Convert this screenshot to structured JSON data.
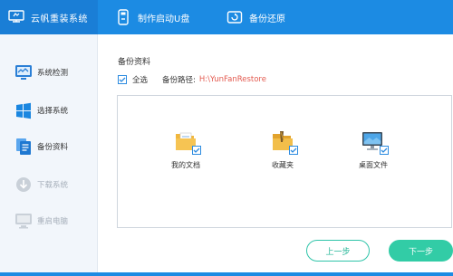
{
  "app": {
    "title": "云帆重装系统"
  },
  "top_tabs": [
    {
      "label": "制作启动U盘",
      "icon": "usb-drive-icon"
    },
    {
      "label": "备份还原",
      "icon": "backup-restore-icon"
    }
  ],
  "sidebar": {
    "items": [
      {
        "label": "系统检测",
        "icon": "system-check-icon",
        "enabled": true
      },
      {
        "label": "选择系统",
        "icon": "windows-icon",
        "enabled": true
      },
      {
        "label": "备份资料",
        "icon": "document-icon",
        "enabled": true
      },
      {
        "label": "下载系统",
        "icon": "download-icon",
        "enabled": false
      },
      {
        "label": "重启电脑",
        "icon": "monitor-icon",
        "enabled": false
      }
    ]
  },
  "main": {
    "section_title": "备份资料",
    "select_all_label": "全选",
    "select_all_checked": true,
    "path_label": "备份路径:",
    "path_value": "H:\\YunFanRestore",
    "files": [
      {
        "name": "我的文档",
        "icon": "documents-folder-icon",
        "checked": true
      },
      {
        "name": "收藏夹",
        "icon": "favorites-folder-icon",
        "checked": true
      },
      {
        "name": "桌面文件",
        "icon": "desktop-icon",
        "checked": true
      }
    ]
  },
  "buttons": {
    "prev": "上一步",
    "next": "下一步"
  },
  "colors": {
    "accent": "#1c8be3",
    "success": "#32cca6",
    "path": "#e35a4f"
  }
}
